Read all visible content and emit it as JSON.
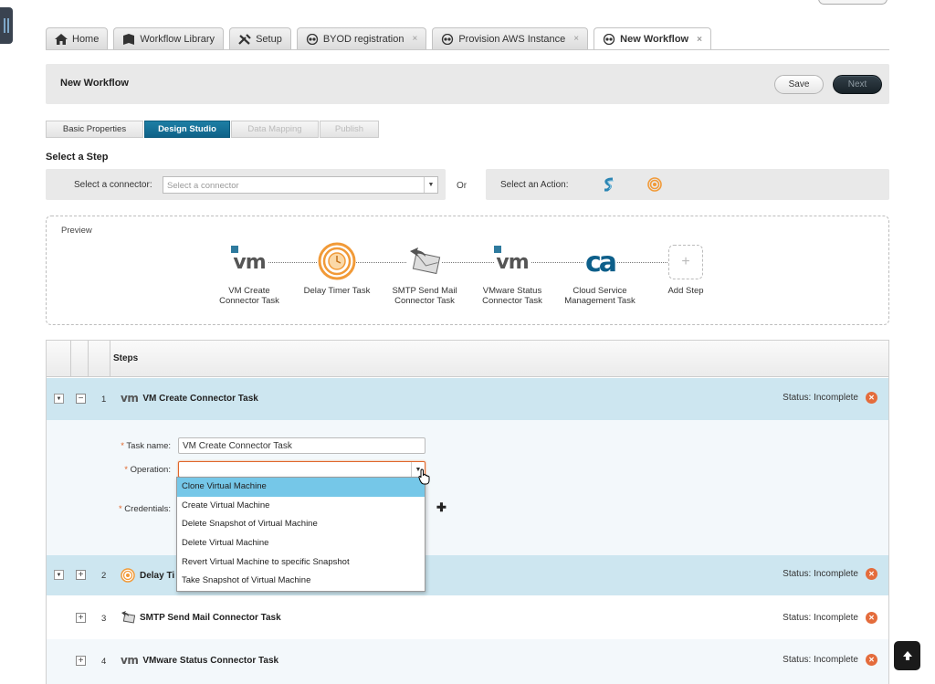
{
  "tabs": [
    {
      "label": "Home",
      "icon": "home-icon",
      "closable": false,
      "active": false
    },
    {
      "label": "Workflow Library",
      "icon": "book-icon",
      "closable": false,
      "active": false
    },
    {
      "label": "Setup",
      "icon": "tools-icon",
      "closable": false,
      "active": false
    },
    {
      "label": "BYOD registration",
      "icon": "workflow-icon",
      "closable": true,
      "active": false
    },
    {
      "label": "Provision AWS Instance",
      "icon": "workflow-icon",
      "closable": true,
      "active": false
    },
    {
      "label": "New Workflow",
      "icon": "workflow-icon",
      "closable": true,
      "active": true
    }
  ],
  "tab_close": "×",
  "header": {
    "title": "New Workflow",
    "save_label": "Save",
    "next_label": "Next"
  },
  "subtabs": [
    {
      "label": "Basic Properties",
      "state": "normal"
    },
    {
      "label": "Design Studio",
      "state": "active"
    },
    {
      "label": "Data Mapping",
      "state": "disabled"
    },
    {
      "label": "Publish",
      "state": "disabled"
    }
  ],
  "select_step": {
    "heading": "Select a Step",
    "connector_label": "Select a connector:",
    "connector_placeholder": "Select a connector",
    "or_label": "Or",
    "action_label": "Select an Action:"
  },
  "preview": {
    "label": "Preview",
    "steps": [
      {
        "label_1": "VM Create",
        "label_2": "Connector Task",
        "icon": "vm-icon"
      },
      {
        "label_1": "Delay Timer Task",
        "label_2": "",
        "icon": "timer-icon"
      },
      {
        "label_1": "SMTP Send Mail",
        "label_2": "Connector Task",
        "icon": "mail-icon"
      },
      {
        "label_1": "VMware Status",
        "label_2": "Connector Task",
        "icon": "vm-icon"
      },
      {
        "label_1": "Cloud Service",
        "label_2": "Management Task",
        "icon": "ca-logo-icon"
      }
    ],
    "add_step_label": "Add Step",
    "vm_text": "vm",
    "ca_text": "ca"
  },
  "steps_table": {
    "header": "Steps",
    "rows": [
      {
        "num": "1",
        "name": "VM Create Connector Task",
        "status": "Status: Incomplete",
        "expanded": true
      },
      {
        "num": "2",
        "name": "Delay Timer Task",
        "status": "Status: Incomplete",
        "expanded": false
      },
      {
        "num": "3",
        "name": "SMTP Send Mail Connector Task",
        "status": "Status: Incomplete",
        "expanded": false
      },
      {
        "num": "4",
        "name": "VMware Status Connector Task",
        "status": "Status: Incomplete",
        "expanded": false
      }
    ],
    "row2_visible_name": "Delay Ti"
  },
  "form": {
    "task_name_label": "Task name:",
    "task_name_value": "VM Create Connector Task",
    "operation_label": "Operation:",
    "operation_value": "",
    "credentials_label": "Credentials:",
    "required_mark": "*"
  },
  "operation_options": [
    "Clone Virtual Machine",
    "Create Virtual Machine",
    "Delete Snapshot of Virtual Machine",
    "Delete Virtual Machine",
    "Revert Virtual Machine to specific Snapshot",
    "Take Snapshot of Virtual Machine"
  ],
  "operation_highlighted": "Clone Virtual Machine",
  "colors": {
    "accent": "#116a92",
    "selected_row": "#cde6f0",
    "status_x": "#e46c3c",
    "highlight": "#75c7e8"
  }
}
